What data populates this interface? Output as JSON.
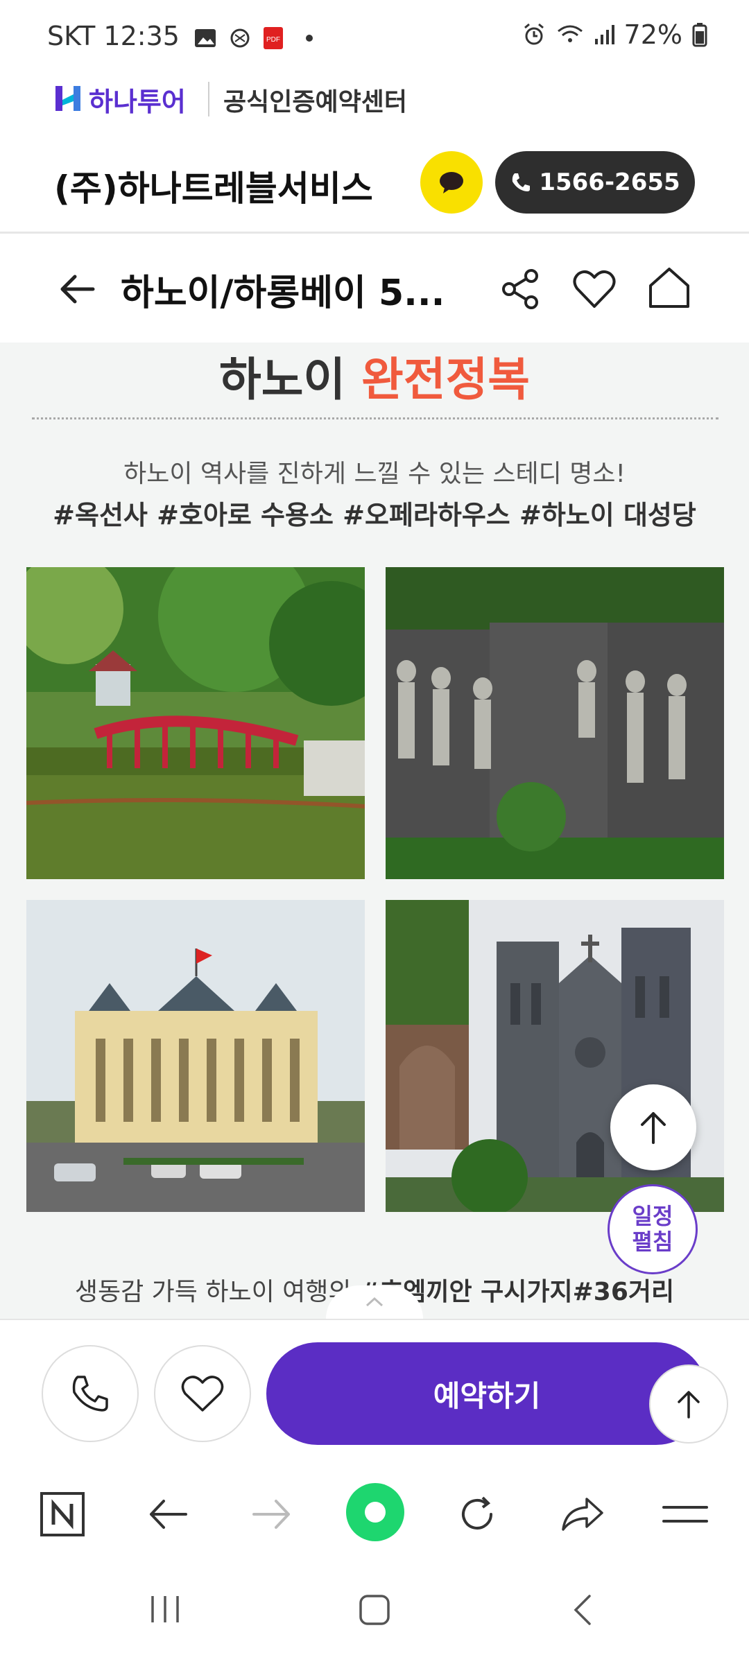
{
  "status_bar": {
    "carrier": "SKT",
    "time": "12:35",
    "battery": "72%"
  },
  "brand": {
    "logo_text": "하나투어",
    "sub_label": "공식인증예약센터"
  },
  "agency": {
    "name": "(주)하나트레블서비스",
    "phone": "1566-2655"
  },
  "title_bar": {
    "title": "하노이/하롱베이 5..."
  },
  "content": {
    "headline_main": "하노이",
    "headline_accent": "완전정복",
    "description": "하노이 역사를 진하게 느낄 수 있는 스테디 명소!",
    "tags": "#옥선사 #호아로 수용소 #오페라하우스 #하노이 대성당",
    "schedule_badge_line1": "일정",
    "schedule_badge_line2": "펼침",
    "bottom_text_prefix": "생동감 가득 하노이 여행의 ",
    "bottom_text_bold": "#호엠끼안 구시가지#36거리"
  },
  "action_bar": {
    "reserve_label": "예약하기"
  },
  "colors": {
    "accent_purple": "#5b2dc4",
    "accent_orange": "#f05a3d",
    "kakao_yellow": "#f9e000"
  }
}
